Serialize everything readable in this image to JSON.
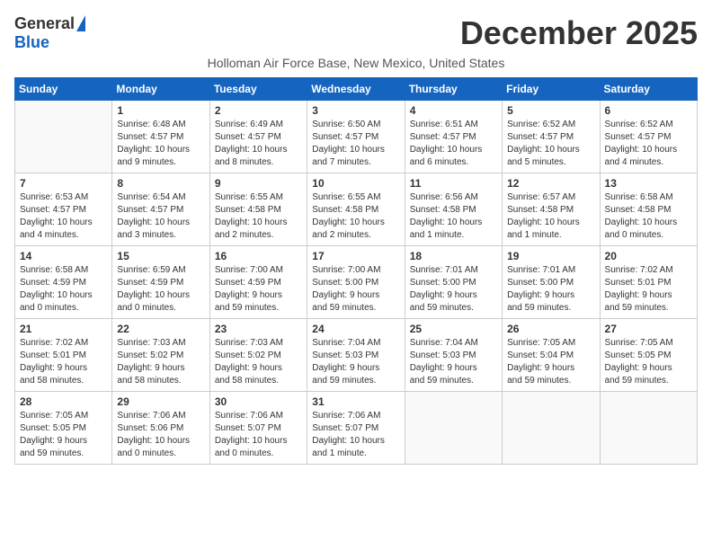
{
  "logo": {
    "general": "General",
    "blue": "Blue"
  },
  "title": "December 2025",
  "subtitle": "Holloman Air Force Base, New Mexico, United States",
  "days_of_week": [
    "Sunday",
    "Monday",
    "Tuesday",
    "Wednesday",
    "Thursday",
    "Friday",
    "Saturday"
  ],
  "weeks": [
    [
      {
        "day": "",
        "info": ""
      },
      {
        "day": "1",
        "info": "Sunrise: 6:48 AM\nSunset: 4:57 PM\nDaylight: 10 hours\nand 9 minutes."
      },
      {
        "day": "2",
        "info": "Sunrise: 6:49 AM\nSunset: 4:57 PM\nDaylight: 10 hours\nand 8 minutes."
      },
      {
        "day": "3",
        "info": "Sunrise: 6:50 AM\nSunset: 4:57 PM\nDaylight: 10 hours\nand 7 minutes."
      },
      {
        "day": "4",
        "info": "Sunrise: 6:51 AM\nSunset: 4:57 PM\nDaylight: 10 hours\nand 6 minutes."
      },
      {
        "day": "5",
        "info": "Sunrise: 6:52 AM\nSunset: 4:57 PM\nDaylight: 10 hours\nand 5 minutes."
      },
      {
        "day": "6",
        "info": "Sunrise: 6:52 AM\nSunset: 4:57 PM\nDaylight: 10 hours\nand 4 minutes."
      }
    ],
    [
      {
        "day": "7",
        "info": "Sunrise: 6:53 AM\nSunset: 4:57 PM\nDaylight: 10 hours\nand 4 minutes."
      },
      {
        "day": "8",
        "info": "Sunrise: 6:54 AM\nSunset: 4:57 PM\nDaylight: 10 hours\nand 3 minutes."
      },
      {
        "day": "9",
        "info": "Sunrise: 6:55 AM\nSunset: 4:58 PM\nDaylight: 10 hours\nand 2 minutes."
      },
      {
        "day": "10",
        "info": "Sunrise: 6:55 AM\nSunset: 4:58 PM\nDaylight: 10 hours\nand 2 minutes."
      },
      {
        "day": "11",
        "info": "Sunrise: 6:56 AM\nSunset: 4:58 PM\nDaylight: 10 hours\nand 1 minute."
      },
      {
        "day": "12",
        "info": "Sunrise: 6:57 AM\nSunset: 4:58 PM\nDaylight: 10 hours\nand 1 minute."
      },
      {
        "day": "13",
        "info": "Sunrise: 6:58 AM\nSunset: 4:58 PM\nDaylight: 10 hours\nand 0 minutes."
      }
    ],
    [
      {
        "day": "14",
        "info": "Sunrise: 6:58 AM\nSunset: 4:59 PM\nDaylight: 10 hours\nand 0 minutes."
      },
      {
        "day": "15",
        "info": "Sunrise: 6:59 AM\nSunset: 4:59 PM\nDaylight: 10 hours\nand 0 minutes."
      },
      {
        "day": "16",
        "info": "Sunrise: 7:00 AM\nSunset: 4:59 PM\nDaylight: 9 hours\nand 59 minutes."
      },
      {
        "day": "17",
        "info": "Sunrise: 7:00 AM\nSunset: 5:00 PM\nDaylight: 9 hours\nand 59 minutes."
      },
      {
        "day": "18",
        "info": "Sunrise: 7:01 AM\nSunset: 5:00 PM\nDaylight: 9 hours\nand 59 minutes."
      },
      {
        "day": "19",
        "info": "Sunrise: 7:01 AM\nSunset: 5:00 PM\nDaylight: 9 hours\nand 59 minutes."
      },
      {
        "day": "20",
        "info": "Sunrise: 7:02 AM\nSunset: 5:01 PM\nDaylight: 9 hours\nand 59 minutes."
      }
    ],
    [
      {
        "day": "21",
        "info": "Sunrise: 7:02 AM\nSunset: 5:01 PM\nDaylight: 9 hours\nand 58 minutes."
      },
      {
        "day": "22",
        "info": "Sunrise: 7:03 AM\nSunset: 5:02 PM\nDaylight: 9 hours\nand 58 minutes."
      },
      {
        "day": "23",
        "info": "Sunrise: 7:03 AM\nSunset: 5:02 PM\nDaylight: 9 hours\nand 58 minutes."
      },
      {
        "day": "24",
        "info": "Sunrise: 7:04 AM\nSunset: 5:03 PM\nDaylight: 9 hours\nand 59 minutes."
      },
      {
        "day": "25",
        "info": "Sunrise: 7:04 AM\nSunset: 5:03 PM\nDaylight: 9 hours\nand 59 minutes."
      },
      {
        "day": "26",
        "info": "Sunrise: 7:05 AM\nSunset: 5:04 PM\nDaylight: 9 hours\nand 59 minutes."
      },
      {
        "day": "27",
        "info": "Sunrise: 7:05 AM\nSunset: 5:05 PM\nDaylight: 9 hours\nand 59 minutes."
      }
    ],
    [
      {
        "day": "28",
        "info": "Sunrise: 7:05 AM\nSunset: 5:05 PM\nDaylight: 9 hours\nand 59 minutes."
      },
      {
        "day": "29",
        "info": "Sunrise: 7:06 AM\nSunset: 5:06 PM\nDaylight: 10 hours\nand 0 minutes."
      },
      {
        "day": "30",
        "info": "Sunrise: 7:06 AM\nSunset: 5:07 PM\nDaylight: 10 hours\nand 0 minutes."
      },
      {
        "day": "31",
        "info": "Sunrise: 7:06 AM\nSunset: 5:07 PM\nDaylight: 10 hours\nand 1 minute."
      },
      {
        "day": "",
        "info": ""
      },
      {
        "day": "",
        "info": ""
      },
      {
        "day": "",
        "info": ""
      }
    ]
  ]
}
